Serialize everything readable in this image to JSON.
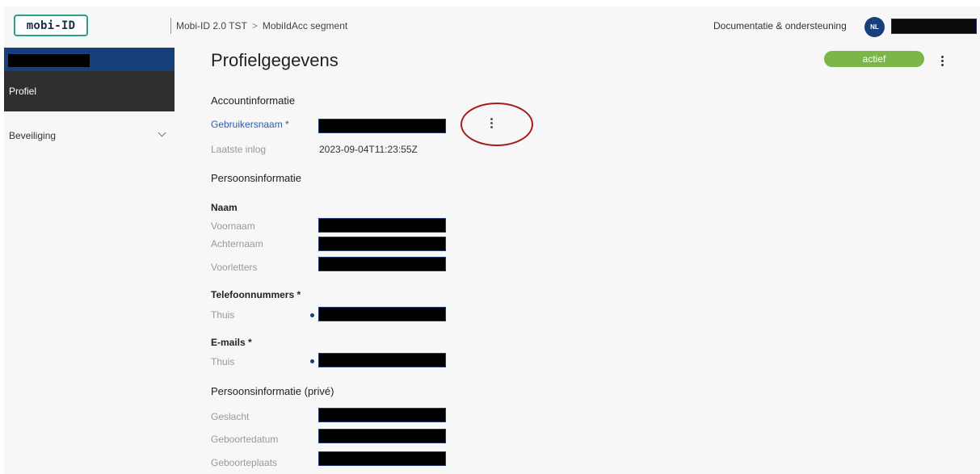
{
  "header": {
    "logo": "mobi-ID",
    "breadcrumb": [
      "Mobi-ID 2.0 TST",
      "MobiIdAcc segment"
    ],
    "breadcrumb_separator": ">",
    "documentation_link": "Documentatie & ondersteuning",
    "language": "NL"
  },
  "sidebar": {
    "items": [
      {
        "label": "Profiel",
        "active": true
      },
      {
        "label": "Beveiliging",
        "active": false,
        "icon": "chevron-down-icon"
      }
    ]
  },
  "main": {
    "title": "Profielgegevens",
    "status": "actief",
    "account_section": {
      "title": "Accountinformatie",
      "username_label": "Gebruikersnaam *",
      "last_login_label": "Laatste inlog",
      "last_login_value": "2023-09-04T11:23:55Z"
    },
    "person_section": {
      "title": "Persoonsinformatie",
      "name_group": "Naam",
      "first_name_label": "Voornaam",
      "last_name_label": "Achternaam",
      "initials_label": "Voorletters",
      "phones_group": "Telefoonnummers *",
      "phone_home_label": "Thuis",
      "emails_group": "E-mails *",
      "email_home_label": "Thuis"
    },
    "private_section": {
      "title": "Persoonsinformatie (privé)",
      "gender_label": "Geslacht",
      "birthdate_label": "Geboortedatum",
      "birthplace_label": "Geboorteplaats"
    }
  },
  "colors": {
    "brand_navy": "#173f7a",
    "logo_teal": "#2e9e87",
    "status_green": "#7ab648",
    "annotation_red": "#a51c1c",
    "sidebar_active": "#2f2f2f"
  }
}
